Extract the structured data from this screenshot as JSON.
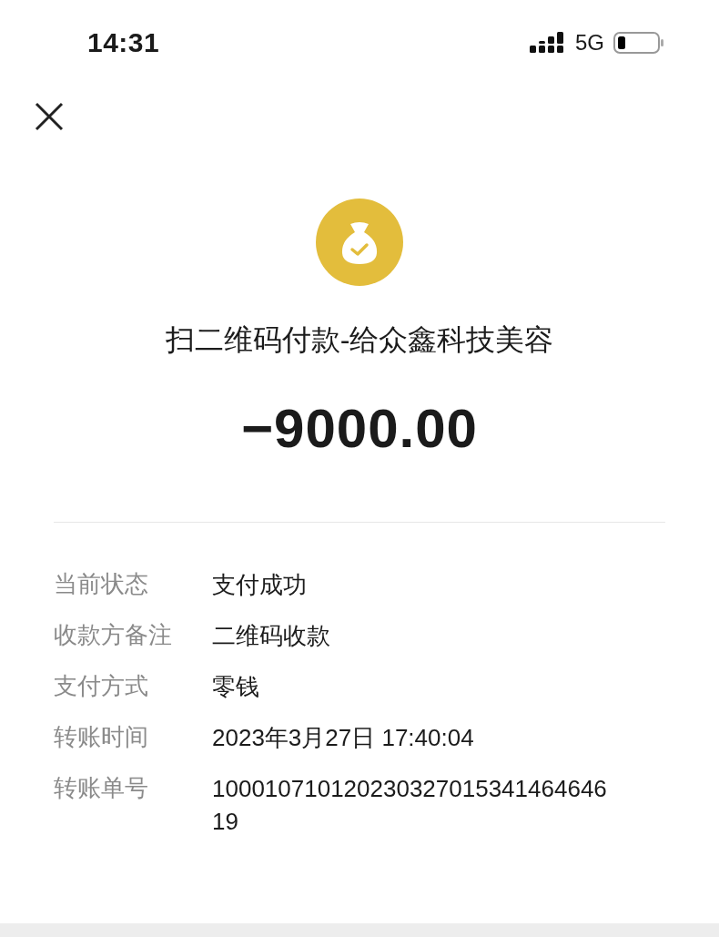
{
  "status_bar": {
    "time": "14:31",
    "network": "5G"
  },
  "header": {
    "title": "扫二维码付款-给众鑫科技美容",
    "amount": "−9000.00"
  },
  "details": [
    {
      "label": "当前状态",
      "value": "支付成功"
    },
    {
      "label": "收款方备注",
      "value": "二维码收款"
    },
    {
      "label": "支付方式",
      "value": "零钱"
    },
    {
      "label": "转账时间",
      "value": "2023年3月27日 17:40:04"
    },
    {
      "label": "转账单号",
      "value": "10001071012023032701534146464619"
    }
  ]
}
